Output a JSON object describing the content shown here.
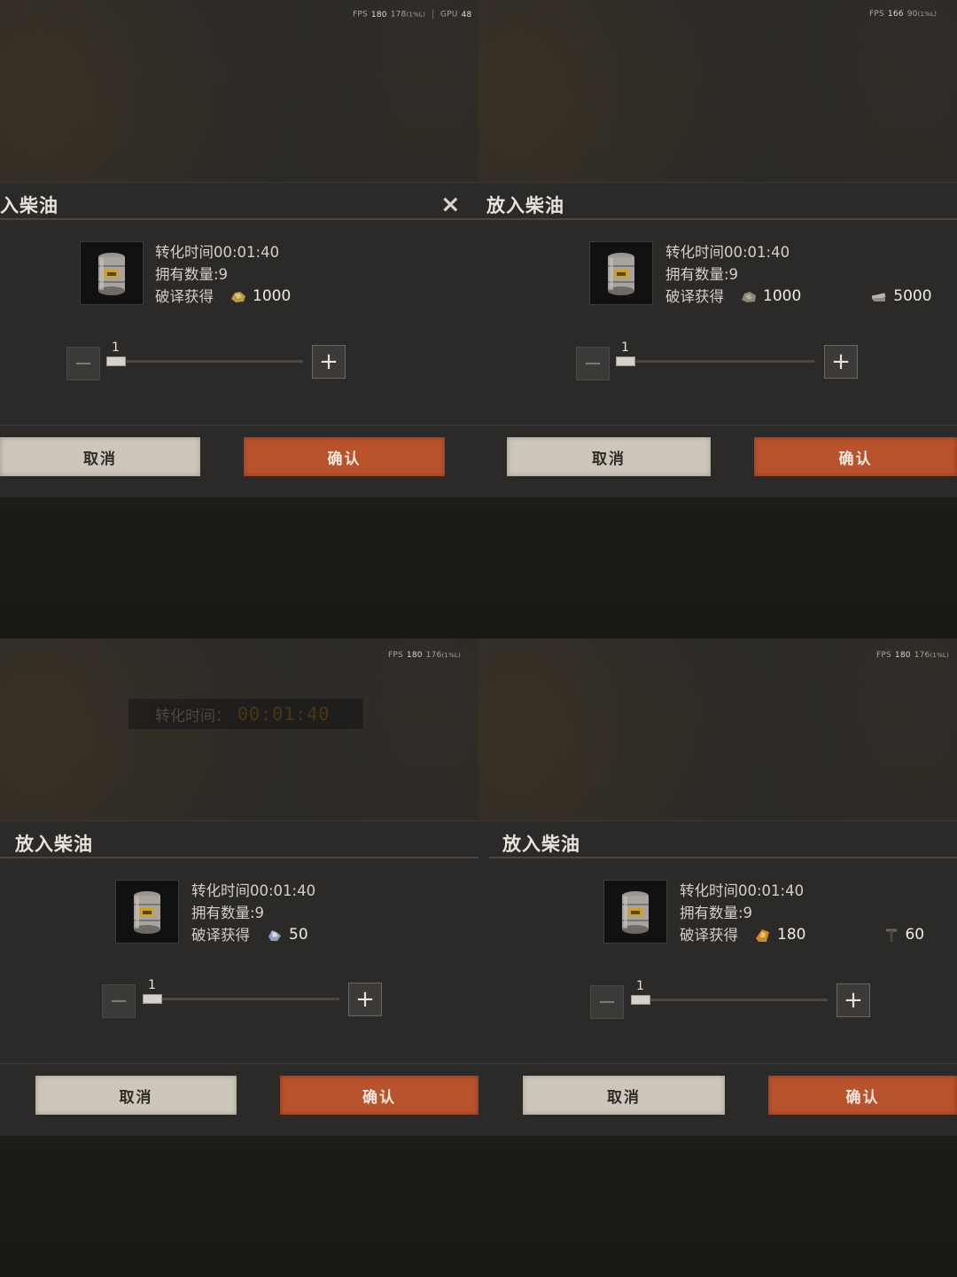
{
  "panels": [
    {
      "fps": {
        "fps_label": "FPS",
        "fps": "180",
        "low": "178",
        "low_tag": "(1%L)",
        "gpu_label": "GPU",
        "gpu": "48"
      },
      "title": "入柴油",
      "close_icon": "×",
      "conversion_time": "转化时间00:01:40",
      "owned": "拥有数量:9",
      "decode_label": "破译获得",
      "rewards": [
        {
          "icon": "gold-ore-icon",
          "value": "1000"
        }
      ],
      "slider_value": "1",
      "cancel": "取消",
      "confirm": "确认"
    },
    {
      "fps": {
        "fps_label": "FPS",
        "fps": "166",
        "low": "90",
        "low_tag": "(1%L)"
      },
      "title": "放入柴油",
      "conversion_time": "转化时间00:01:40",
      "owned": "拥有数量:9",
      "decode_label": "破译获得",
      "rewards": [
        {
          "icon": "ore-icon",
          "value": "1000"
        },
        {
          "icon": "metal-scrap-icon",
          "value": "5000"
        }
      ],
      "slider_value": "1",
      "cancel": "取消",
      "confirm": "确认"
    },
    {
      "fps": {
        "fps_label": "FPS",
        "fps": "180",
        "low": "176",
        "low_tag": "(1%L)"
      },
      "timer_banner": {
        "label": "转化时间：",
        "value": "00:01:40"
      },
      "title": "放入柴油",
      "conversion_time": "转化时间00:01:40",
      "owned": "拥有数量:9",
      "decode_label": "破译获得",
      "rewards": [
        {
          "icon": "crystal-icon",
          "value": "50"
        }
      ],
      "slider_value": "1",
      "cancel": "取消",
      "confirm": "确认"
    },
    {
      "fps": {
        "fps_label": "FPS",
        "fps": "180",
        "low": "176",
        "low_tag": "(1%L)"
      },
      "title": "放入柴油",
      "conversion_time": "转化时间00:01:40",
      "owned": "拥有数量:9",
      "decode_label": "破译获得",
      "rewards": [
        {
          "icon": "amber-icon",
          "value": "180"
        },
        {
          "icon": "pickaxe-icon",
          "value": "60"
        }
      ],
      "slider_value": "1",
      "cancel": "取消",
      "confirm": "确认"
    }
  ],
  "colors": {
    "confirm": "#b8532d",
    "cancel": "#cdc7bb",
    "panel": "#2b2a28"
  }
}
